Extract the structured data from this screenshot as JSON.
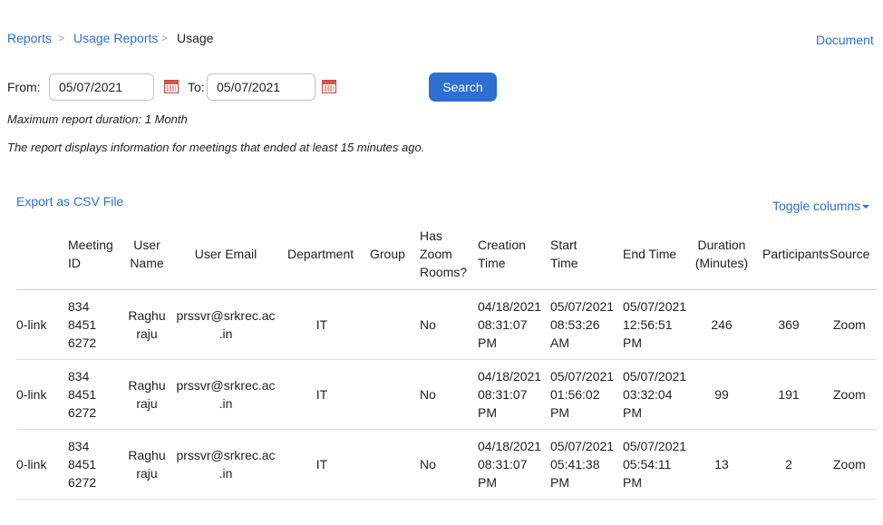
{
  "breadcrumb": {
    "items": [
      "Reports",
      "Usage Reports",
      "Usage"
    ],
    "separator": ">"
  },
  "document_link": "Document",
  "filter": {
    "from_label": "From:",
    "from_value": "05/07/2021",
    "to_label": "To:",
    "to_value": "05/07/2021",
    "search_label": "Search"
  },
  "notes": {
    "max_duration": "Maximum report duration: 1 Month",
    "info": "The report displays information for meetings that ended at least 15 minutes ago."
  },
  "actions": {
    "export": "Export as CSV File",
    "toggle": "Toggle columns"
  },
  "columns": {
    "meeting_id": [
      "Meeting",
      "ID"
    ],
    "user_name": [
      "User",
      "Name"
    ],
    "user_email": "User Email",
    "department": "Department",
    "group": "Group",
    "zoom_rooms": [
      "Has",
      "Zoom",
      "Rooms?"
    ],
    "creation": [
      "Creation",
      "Time"
    ],
    "start": [
      "Start",
      "Time"
    ],
    "end": "End Time",
    "duration": [
      "Duration",
      "(Minutes)"
    ],
    "participants": "Participants",
    "source": "Source"
  },
  "rows": [
    {
      "topic": "0-link",
      "meeting_id": [
        "834",
        "8451",
        "6272"
      ],
      "user_name": [
        "Raghu",
        "raju"
      ],
      "user_email": [
        "prssvr@srkrec.ac",
        ".in"
      ],
      "department": "IT",
      "group": "",
      "zoom_rooms": "No",
      "creation": [
        "04/18/2021",
        "08:31:07",
        "PM"
      ],
      "start": [
        "05/07/2021",
        "08:53:26",
        "AM"
      ],
      "end": [
        "05/07/2021",
        "12:56:51",
        "PM"
      ],
      "duration": "246",
      "participants": "369",
      "source": "Zoom"
    },
    {
      "topic": "0-link",
      "meeting_id": [
        "834",
        "8451",
        "6272"
      ],
      "user_name": [
        "Raghu",
        "raju"
      ],
      "user_email": [
        "prssvr@srkrec.ac",
        ".in"
      ],
      "department": "IT",
      "group": "",
      "zoom_rooms": "No",
      "creation": [
        "04/18/2021",
        "08:31:07",
        "PM"
      ],
      "start": [
        "05/07/2021",
        "01:56:02",
        "PM"
      ],
      "end": [
        "05/07/2021",
        "03:32:04",
        "PM"
      ],
      "duration": "99",
      "participants": "191",
      "source": "Zoom"
    },
    {
      "topic": "0-link",
      "meeting_id": [
        "834",
        "8451",
        "6272"
      ],
      "user_name": [
        "Raghu",
        "raju"
      ],
      "user_email": [
        "prssvr@srkrec.ac",
        ".in"
      ],
      "department": "IT",
      "group": "",
      "zoom_rooms": "No",
      "creation": [
        "04/18/2021",
        "08:31:07",
        "PM"
      ],
      "start": [
        "05/07/2021",
        "05:41:38",
        "PM"
      ],
      "end": [
        "05/07/2021",
        "05:54:11",
        "PM"
      ],
      "duration": "13",
      "participants": "2",
      "source": "Zoom"
    }
  ]
}
